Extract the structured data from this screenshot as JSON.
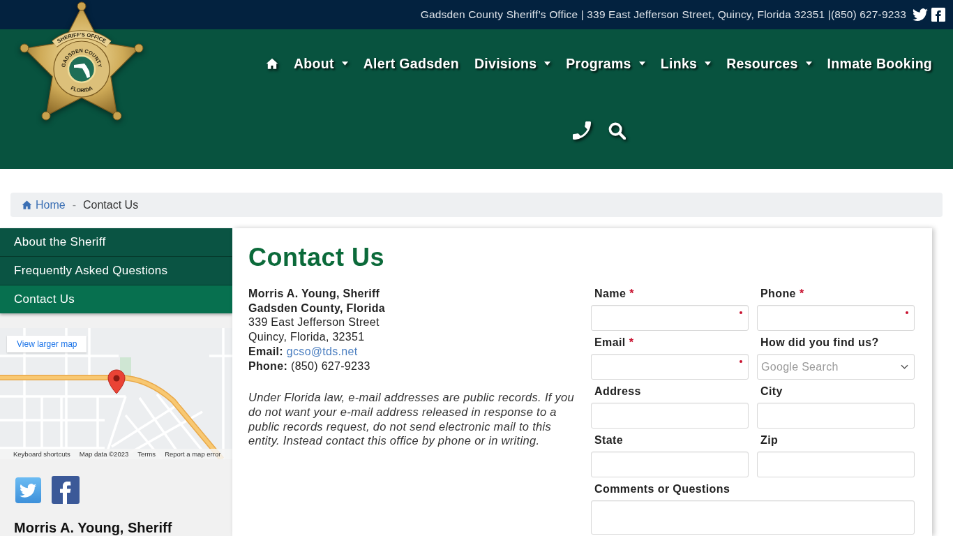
{
  "top_bar": {
    "text": "Gadsden County Sheriff’s Office | 339 East Jefferson Street, Quincy, Florida 32351 |(850) 627-9233"
  },
  "logo": {
    "top_text": "SHERIFF’S OFFICE",
    "middle_text": "GADSDEN COUNTY",
    "bottom_text": "FLORIDA"
  },
  "nav": {
    "items": [
      {
        "label": "About",
        "has_menu": true
      },
      {
        "label": "Alert Gadsden",
        "has_menu": false
      },
      {
        "label": "Divisions",
        "has_menu": true
      },
      {
        "label": "Programs",
        "has_menu": true
      },
      {
        "label": "Links",
        "has_menu": true
      },
      {
        "label": "Resources",
        "has_menu": true
      },
      {
        "label": "Inmate Booking",
        "has_menu": false
      }
    ]
  },
  "breadcrumb": {
    "separator": "-",
    "items": [
      {
        "label": "Home",
        "kind": "home"
      },
      {
        "label": "Contact Us",
        "kind": "current"
      }
    ]
  },
  "sidebar": {
    "menu": [
      {
        "label": "About the Sheriff",
        "selected": false
      },
      {
        "label": "Frequently Asked Questions",
        "selected": false
      },
      {
        "label": "Contact Us",
        "selected": true
      }
    ],
    "map": {
      "link": "View larger map",
      "attribution": [
        "Keyboard shortcuts",
        "Map data ©2023",
        "Terms",
        "Report a map error"
      ]
    },
    "heading": "Morris A. Young, Sheriff"
  },
  "main": {
    "title": "Contact Us",
    "contact": {
      "name": "Morris A. Young, Sheriff",
      "county": "Gadsden County, Florida",
      "address": [
        "339 East Jefferson Street",
        "Quincy, Florida, 32351"
      ],
      "email_label": "Email:",
      "email": "gcso@tds.net",
      "phone_label": "Phone:",
      "phone": "(850) 627-9233"
    },
    "notice": "Under Florida law, e-mail addresses are public records. If you do not want your e-mail address released in response to a public records request, do not send electronic mail to this entity. Instead contact this office by phone or in writing."
  },
  "form": {
    "required_mark": "*",
    "fields": [
      {
        "label": "Name",
        "required": true,
        "kind": "text"
      },
      {
        "label": "Phone",
        "required": true,
        "kind": "text"
      },
      {
        "label": "Email",
        "required": true,
        "kind": "text"
      },
      {
        "label": "How did you find us?",
        "required": false,
        "kind": "select",
        "value": "Google Search"
      },
      {
        "label": "Address",
        "required": false,
        "kind": "text"
      },
      {
        "label": "City",
        "required": false,
        "kind": "text"
      },
      {
        "label": "State",
        "required": false,
        "kind": "text"
      },
      {
        "label": "Zip",
        "required": false,
        "kind": "text"
      },
      {
        "label": "Comments or Questions",
        "required": false,
        "kind": "textarea"
      }
    ]
  }
}
